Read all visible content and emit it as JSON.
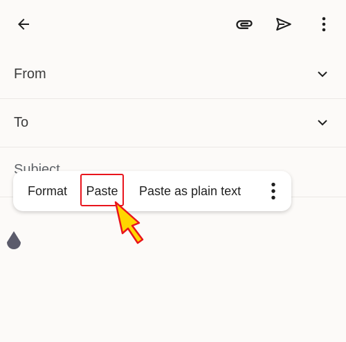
{
  "appbar": {
    "icons": [
      "arrow-back-icon",
      "paperclip-icon",
      "send-icon",
      "more-vert-icon"
    ]
  },
  "form": {
    "from_label": "From",
    "to_label": "To",
    "subject_label": "Subject"
  },
  "context_menu": {
    "items": [
      "Format",
      "Paste",
      "Paste as plain text"
    ],
    "more_icon": "more-vert-icon",
    "highlighted_item": "Paste",
    "highlight_color": "#e8141c"
  },
  "colors": {
    "background": "#fcfaf8",
    "pointer_fill": "#ffd600",
    "pointer_stroke": "#e8141c",
    "drop_handle": "#5b5b6b"
  }
}
